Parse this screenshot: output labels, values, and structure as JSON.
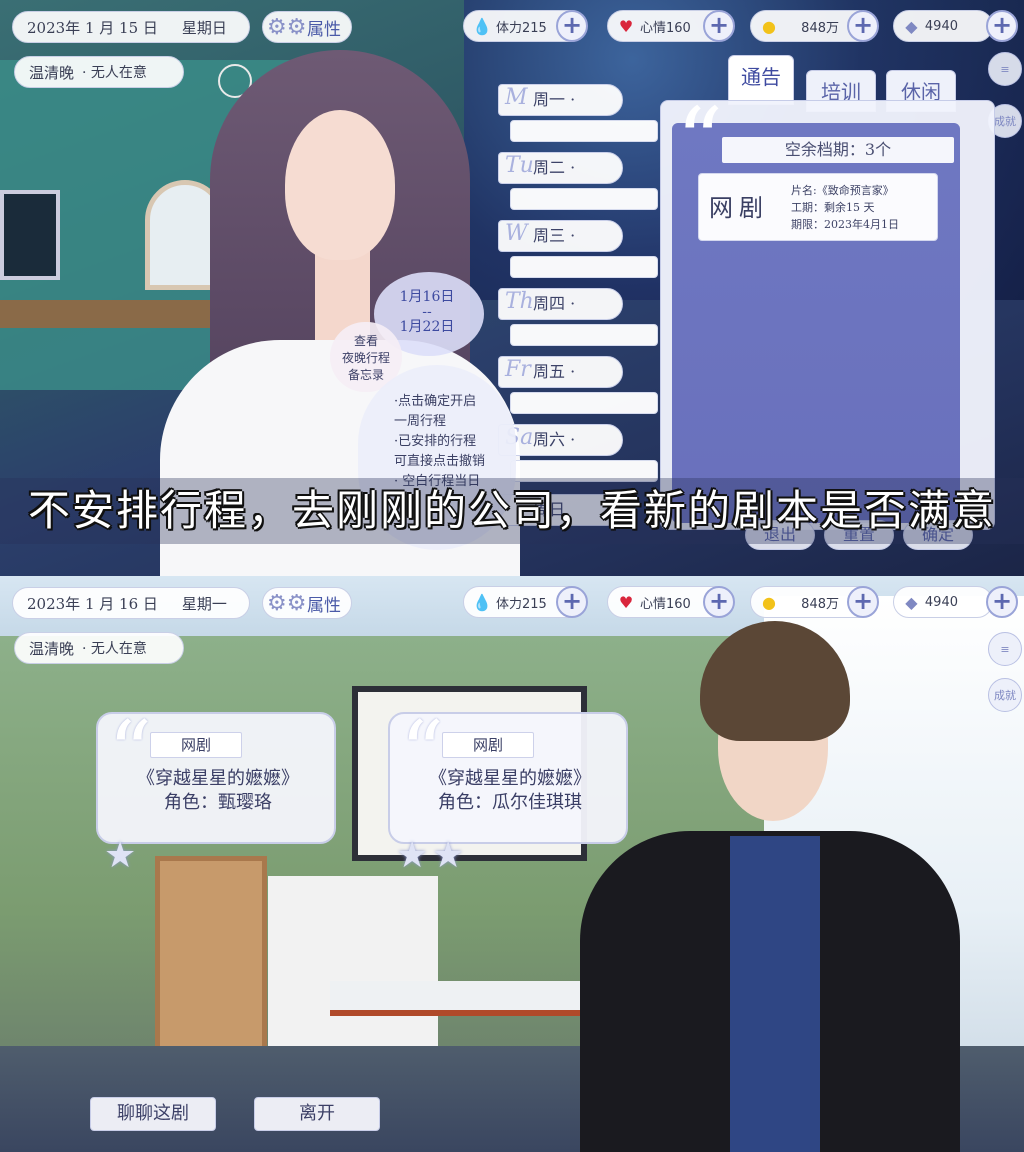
{
  "screen1": {
    "hud": {
      "date": "2023年 1 月 15 日",
      "weekday": "星期日",
      "attr_label": "属性",
      "player_name": "温清晚",
      "player_status": "· 无人在意",
      "stamina": "体力215",
      "mood": "心情160",
      "money": "848万",
      "diamonds": "4940"
    },
    "tabs": [
      "通告",
      "培训",
      "休闲"
    ],
    "days": [
      "周一 ·",
      "周二 ·",
      "周三 ·",
      "周四 ·",
      "周五 ·",
      "周六 ·",
      "周日"
    ],
    "day_script": [
      "M",
      "Tu",
      "W",
      "Th",
      "Fr",
      "Sa",
      ""
    ],
    "vacancy": "空余档期：3个",
    "job": {
      "type": "网剧",
      "title": "片名:《致命预言家》",
      "duration": "工期：剩余15 天",
      "deadline": "期限：2023年4月1日"
    },
    "range": {
      "from": "1月16日",
      "sep": "--",
      "to": "1月22日"
    },
    "memo": [
      "查看",
      "夜晚行程",
      "备忘录"
    ],
    "tips": [
      "·点击确定开启",
      "一周行程",
      "·已安排的行程",
      "可直接点击撤销",
      "· 空白行程当日"
    ],
    "bottom_buttons": [
      "退出",
      "重置",
      "确定"
    ],
    "side_buttons": [
      "≡",
      "成就"
    ],
    "subtitle": "不安排行程，去刚刚的公司，看新的剧本是否满意"
  },
  "screen2": {
    "hud": {
      "date": "2023年 1 月 16 日",
      "weekday": "星期一",
      "attr_label": "属性",
      "player_name": "温清晚",
      "player_status": "· 无人在意",
      "stamina": "体力215",
      "mood": "心情160",
      "money": "848万",
      "diamonds": "4940"
    },
    "cards": [
      {
        "tag": "网剧",
        "title": "《穿越星星的嬷嬷》",
        "role": "角色：甄璎珞"
      },
      {
        "tag": "网剧",
        "title": "《穿越星星的嬷嬷》",
        "role": "角色：瓜尔佳琪琪"
      }
    ],
    "actions": [
      "聊聊这剧",
      "离开"
    ],
    "side_buttons": [
      "≡",
      "成就"
    ]
  },
  "icons": {
    "stamina": "water-drop-icon",
    "mood": "heart-icon",
    "money": "coin-icon",
    "diamonds": "diamond-icon",
    "attr": "gear-icon",
    "plus": "plus-icon"
  },
  "colors": {
    "accent": "#5a64a8",
    "panel": "#6f78c2",
    "heart": "#d9263c",
    "coin": "#f2c21a",
    "drop": "#2f8fd6"
  }
}
